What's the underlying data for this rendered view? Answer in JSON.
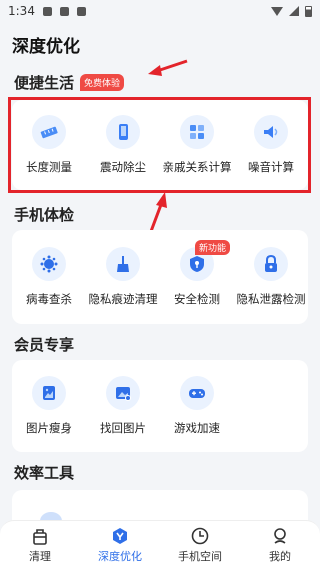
{
  "status_bar": {
    "time": "1:34"
  },
  "page_title": "深度优化",
  "sections": {
    "convenient": {
      "title": "便捷生活",
      "badge": "免费体验",
      "items": [
        {
          "label": "长度测量",
          "icon": "ruler-icon"
        },
        {
          "label": "震动除尘",
          "icon": "phone-vibrate-icon"
        },
        {
          "label": "亲戚关系计算",
          "icon": "relatives-calc-icon"
        },
        {
          "label": "噪音计算",
          "icon": "speaker-icon"
        }
      ]
    },
    "checkup": {
      "title": "手机体检",
      "items": [
        {
          "label": "病毒查杀",
          "icon": "virus-icon"
        },
        {
          "label": "隐私痕迹清理",
          "icon": "broom-icon"
        },
        {
          "label": "安全检测",
          "icon": "shield-icon",
          "badge": "新功能"
        },
        {
          "label": "隐私泄露检测",
          "icon": "lock-icon"
        }
      ]
    },
    "member": {
      "title": "会员专享",
      "items": [
        {
          "label": "图片瘦身",
          "icon": "photo-slim-icon"
        },
        {
          "label": "找回图片",
          "icon": "photo-recover-icon"
        },
        {
          "label": "游戏加速",
          "icon": "gamepad-icon"
        }
      ]
    },
    "efficiency": {
      "title": "效率工具"
    }
  },
  "bottom_nav": [
    {
      "label": "清理",
      "icon": "clean-icon",
      "active": false
    },
    {
      "label": "深度优化",
      "icon": "deep-optimize-icon",
      "active": true
    },
    {
      "label": "手机空间",
      "icon": "storage-icon",
      "active": false
    },
    {
      "label": "我的",
      "icon": "profile-icon",
      "active": false
    }
  ],
  "colors": {
    "accent": "#2f6fe8",
    "annotation_red": "#e3242b",
    "badge_red": "#ef4a44"
  }
}
